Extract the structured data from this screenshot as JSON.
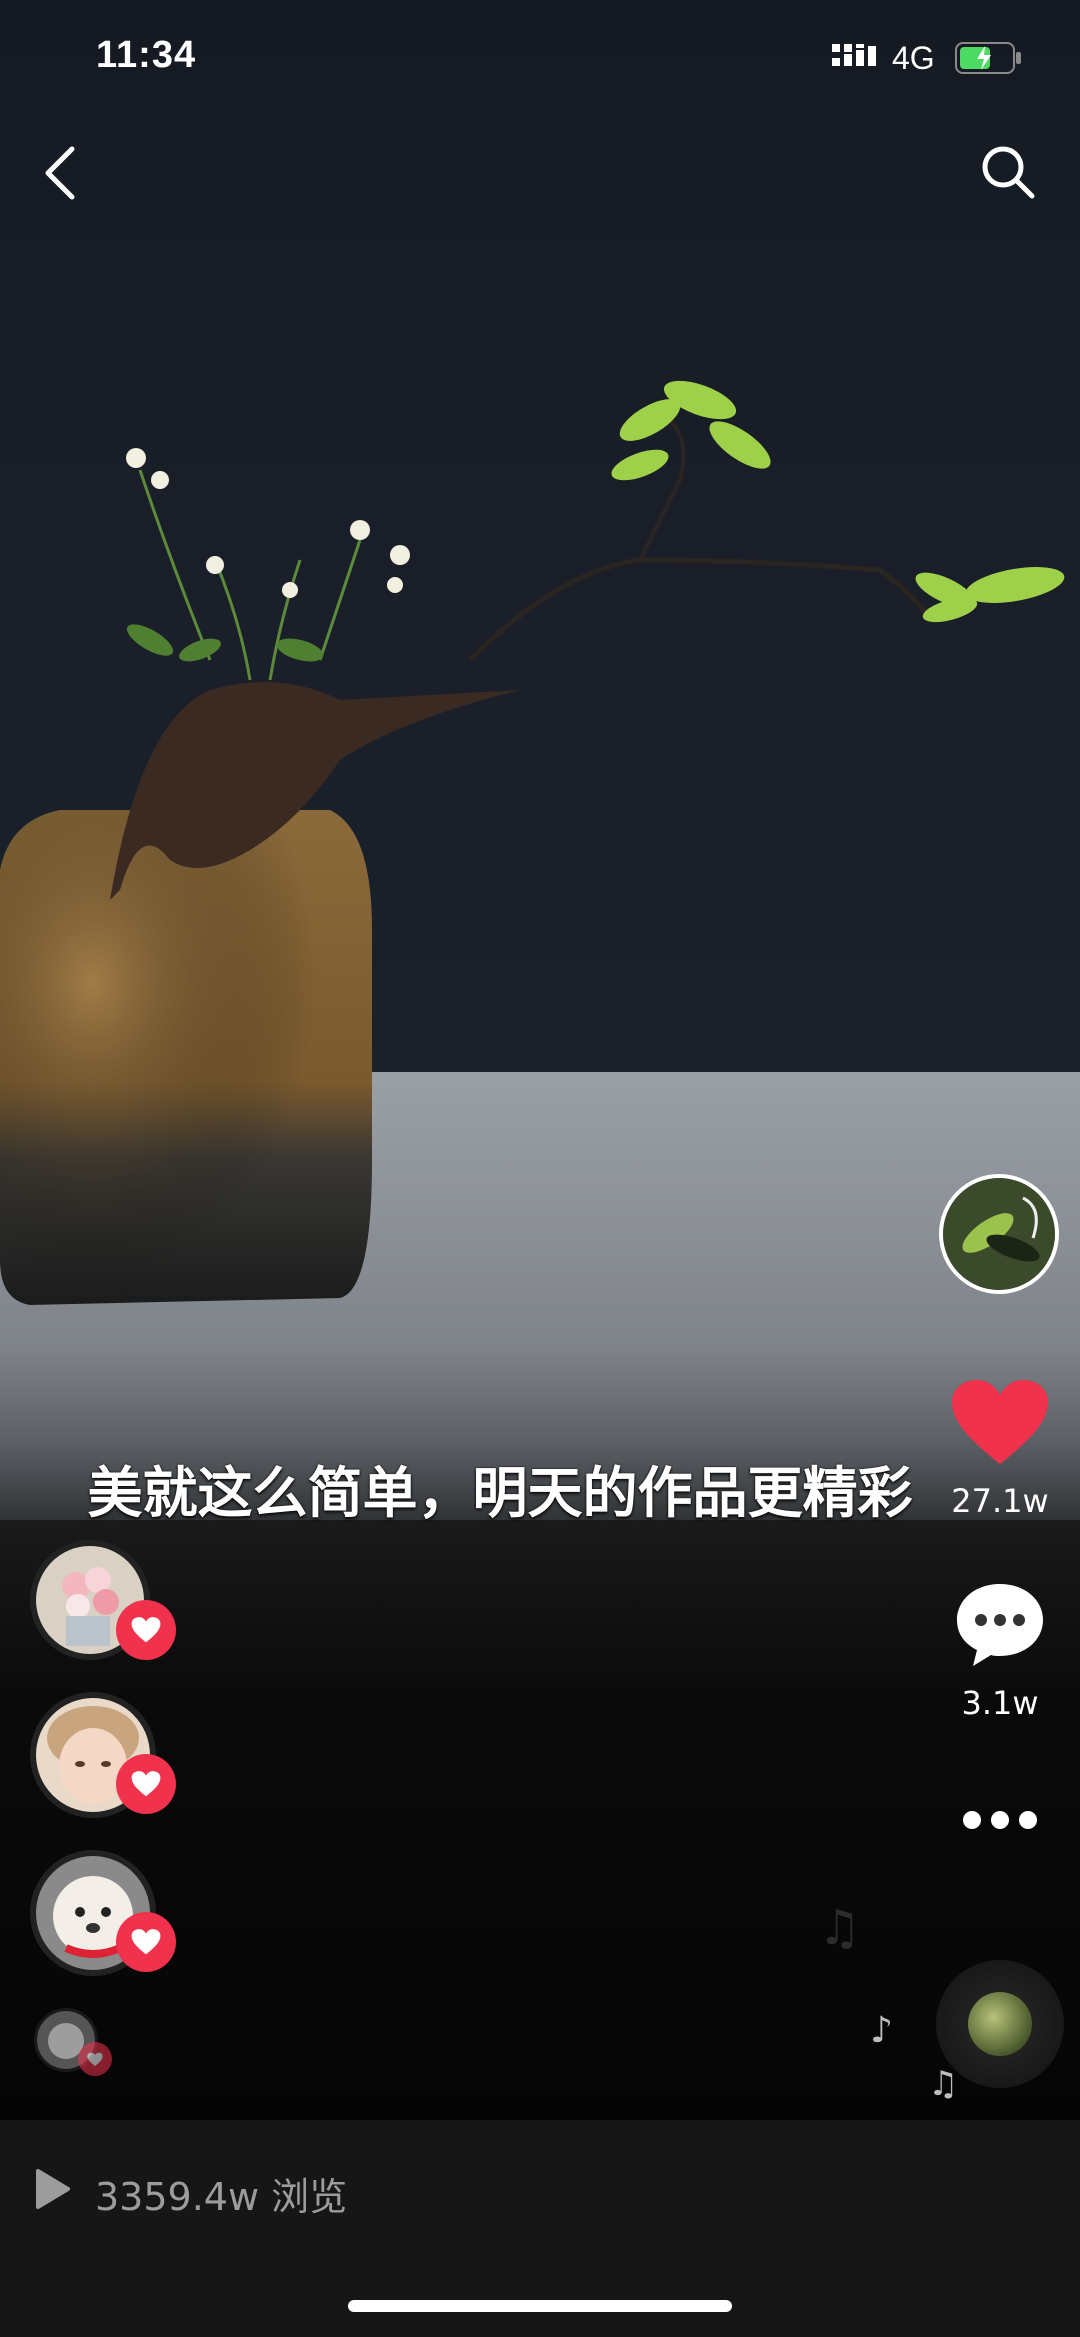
{
  "status_bar": {
    "time": "11:34",
    "network": "4G"
  },
  "video": {
    "caption": "美就这么简单，明天的作品更精彩",
    "likes": "27.1w",
    "comments": "3.1w"
  },
  "footer": {
    "views": "3359.4w 浏览"
  },
  "colors": {
    "accent": "#f0324d",
    "bar_bg": "#161616"
  },
  "icons": [
    "back-icon",
    "search-icon",
    "heart-icon",
    "comment-icon",
    "more-icon",
    "music-note-icon",
    "play-icon"
  ]
}
